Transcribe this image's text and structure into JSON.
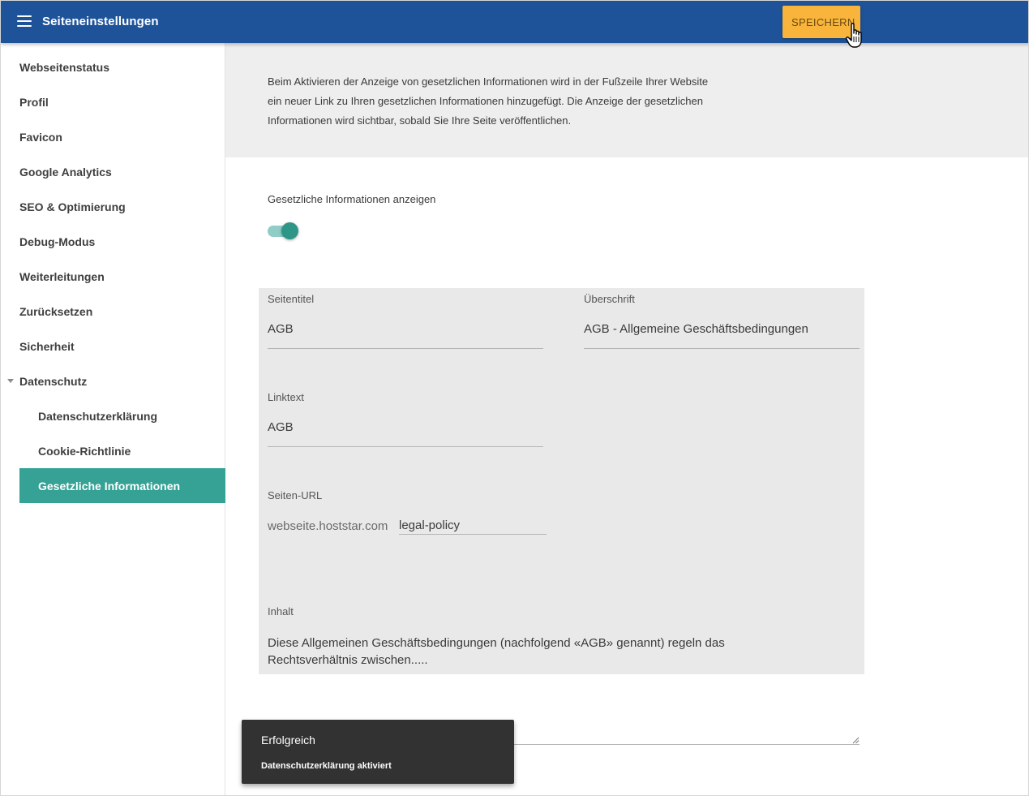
{
  "header": {
    "title": "Seiteneinstellungen",
    "save_label": "SPEICHERN"
  },
  "sidebar": {
    "items": [
      {
        "label": "Webseitenstatus"
      },
      {
        "label": "Profil"
      },
      {
        "label": "Favicon"
      },
      {
        "label": "Google Analytics"
      },
      {
        "label": "SEO & Optimierung"
      },
      {
        "label": "Debug-Modus"
      },
      {
        "label": "Weiterleitungen"
      },
      {
        "label": "Zurücksetzen"
      },
      {
        "label": "Sicherheit"
      },
      {
        "label": "Datenschutz"
      }
    ],
    "subitems": [
      {
        "label": "Datenschutzerklärung"
      },
      {
        "label": "Cookie-Richtlinie"
      },
      {
        "label": "Gesetzliche Informationen"
      }
    ],
    "active_item": "Gesetzliche Informationen"
  },
  "info": {
    "line1": "Beim Aktivieren der Anzeige von gesetzlichen Informationen wird in der Fußzeile Ihrer Website",
    "line2": "ein neuer Link zu Ihren gesetzlichen Informationen hinzugefügt. Die Anzeige der gesetzlichen",
    "line3": "Informationen wird sichtbar, sobald Sie Ihre Seite veröffentlichen."
  },
  "toggle": {
    "label": "Gesetzliche Informationen anzeigen",
    "on": true
  },
  "form": {
    "page_title_label": "Seitentitel",
    "page_title_value": "AGB",
    "heading_label": "Überschrift",
    "heading_value": "AGB - Allgemeine Geschäftsbedingungen",
    "link_text_label": "Linktext",
    "link_text_value": "AGB",
    "url_label": "Seiten-URL",
    "url_prefix": "webseite.hoststar.com",
    "url_value": "legal-policy",
    "content_label": "Inhalt",
    "content_line1": "Diese Allgemeinen Geschäftsbedingungen (nachfolgend «AGB» genannt) regeln das",
    "content_line2": "Rechtsverhältnis zwischen....."
  },
  "snackbar": {
    "title": "Erfolgreich",
    "message": "Datenschutzerklärung aktiviert"
  },
  "colors": {
    "header": "#1f5399",
    "save_button": "#f9b53b",
    "active_nav": "#36a195",
    "toggle_on": "#2e9687"
  }
}
